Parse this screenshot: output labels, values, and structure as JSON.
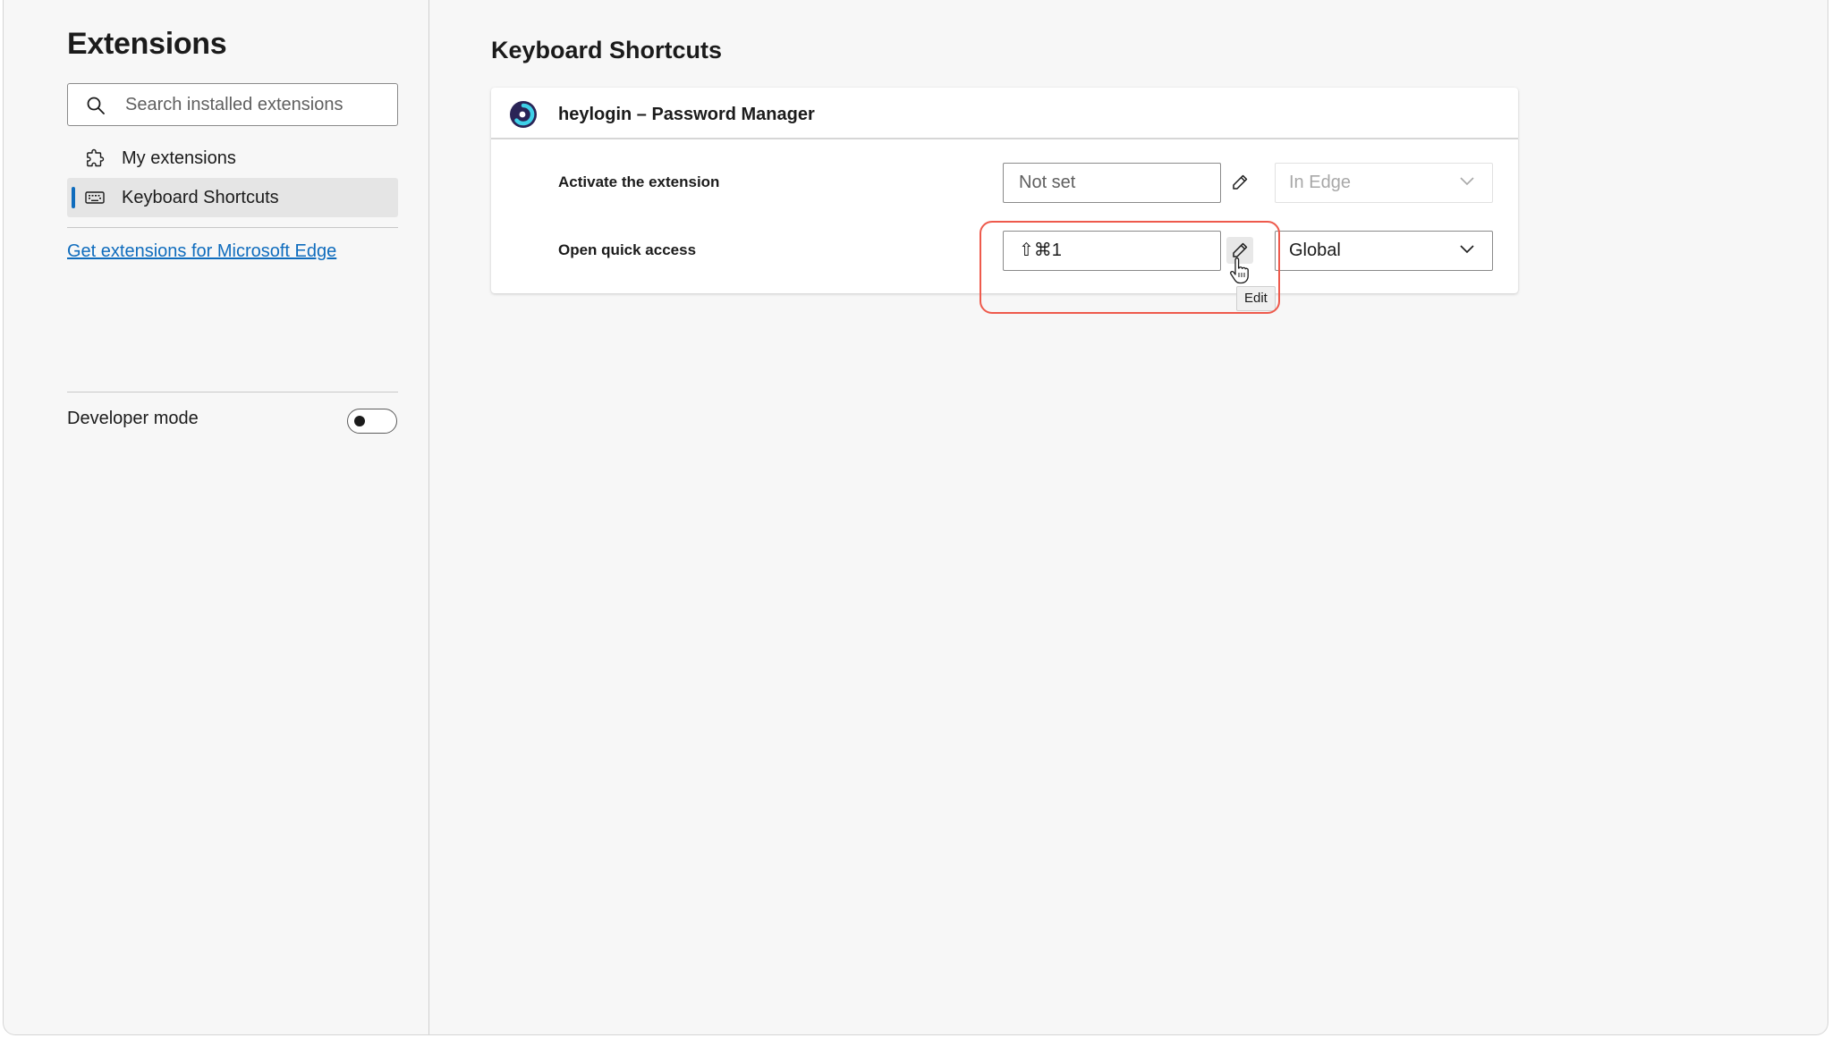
{
  "sidebar": {
    "title": "Extensions",
    "search": {
      "placeholder": "Search installed extensions",
      "value": ""
    },
    "items": [
      {
        "label": "My extensions",
        "icon": "puzzle-icon",
        "active": false
      },
      {
        "label": "Keyboard Shortcuts",
        "icon": "keyboard-icon",
        "active": true
      }
    ],
    "store_link": "Get extensions for Microsoft Edge",
    "developer_mode": {
      "label": "Developer mode",
      "enabled": false
    }
  },
  "main": {
    "title": "Keyboard Shortcuts",
    "extension": {
      "name": "heylogin – Password Manager",
      "icon": "heylogin-logo-icon",
      "shortcuts": [
        {
          "label": "Activate the extension",
          "value": "Not set",
          "scope": "In Edge",
          "scope_disabled": true
        },
        {
          "label": "Open quick access",
          "value": "⇧⌘1",
          "scope": "Global",
          "scope_disabled": false
        }
      ]
    },
    "tooltip": "Edit"
  },
  "colors": {
    "accent": "#0f6cbd",
    "highlight": "#ee5a4c",
    "background": "#f7f7f7"
  }
}
